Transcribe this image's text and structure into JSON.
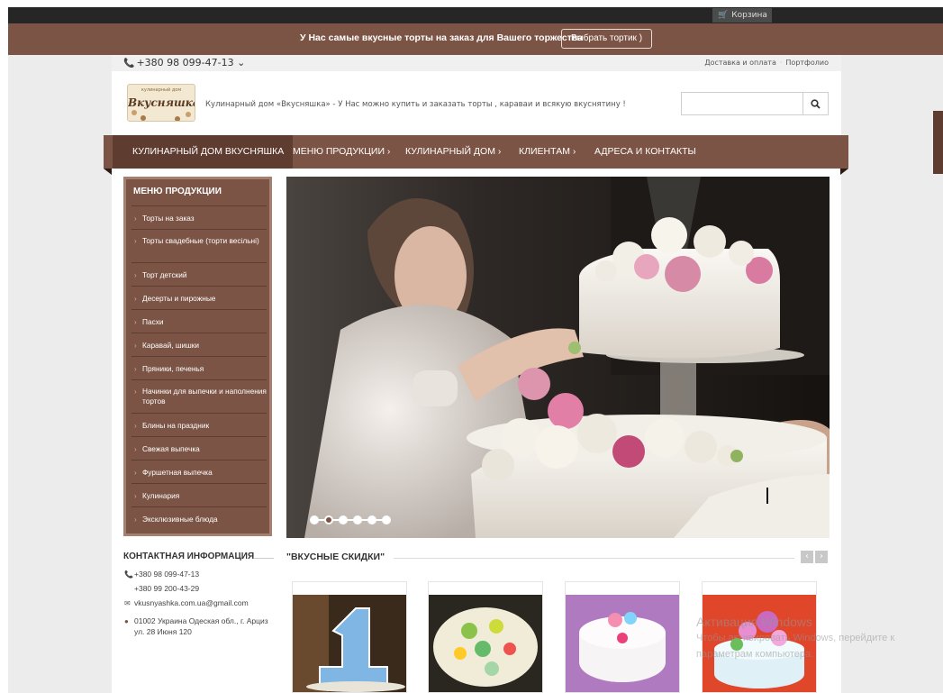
{
  "topbar": {
    "cart_label": "Корзина",
    "cart_icon": "cart-icon"
  },
  "promo": {
    "text": "У Нас самые вкусные торты на заказ для Вашего торжества",
    "button_label": "Выбрать тортик )"
  },
  "header": {
    "phone": "+380 98 099-47-13",
    "phone_caret": "⌄",
    "links": [
      "Доставка и оплата",
      "Портфолио"
    ],
    "logo_small": "кулинарный дом",
    "logo_main": "Вкусняшка",
    "tagline": "Кулинарный дом «Вкусняшка» - У Нас можно купить и заказать торты , караваи и всякую вкуснятину !",
    "search_value": "",
    "search_icon": "search-icon"
  },
  "nav": {
    "items": [
      {
        "label": "КУЛИНАРНЫЙ ДОМ ВКУСНЯШКА",
        "active": true
      },
      {
        "label": "МЕНЮ ПРОДУКЦИИ ›"
      },
      {
        "label": "КУЛИНАРНЫЙ ДОМ ›"
      },
      {
        "label": "КЛИЕНТАМ ›"
      },
      {
        "label": "АДРЕСА И КОНТАКТЫ"
      }
    ]
  },
  "sidebar": {
    "title": "МЕНЮ ПРОДУКЦИИ",
    "items": [
      "Торты на заказ",
      "Торты свадебные (торти весільні)",
      "Торт детский",
      "Десерты и пирожные",
      "Пасхи",
      "Каравай, шишки",
      "Пряники, печенья",
      "Начинки для выпечки и наполнения тортов",
      "Блины на праздник",
      "Свежая выпечка",
      "Фуршетная выпечка",
      "Кулинария",
      "Эксклюзивные блюда"
    ]
  },
  "slider": {
    "dot_count": 6,
    "active_dot": 1
  },
  "contact": {
    "title": "КОНТАКТНАЯ ИНФОРМАЦИЯ",
    "phone1": "+380 98 099-47-13",
    "phone2": "+380 99 200-43-29",
    "email": "vkusnyashka.com.ua@gmail.com",
    "address_line1": "01002 Украина Одеская обл., г. Арциз",
    "address_line2": "ул. 28 Июня 120"
  },
  "discounts": {
    "title": "\"ВКУСНЫЕ СКИДКИ\"",
    "prev": "‹",
    "next": "›"
  },
  "watermark": {
    "line1": "Активация Windows",
    "line2": "Чтобы активировать Windows, перейдите к",
    "line3": "параметрам компьютера."
  }
}
